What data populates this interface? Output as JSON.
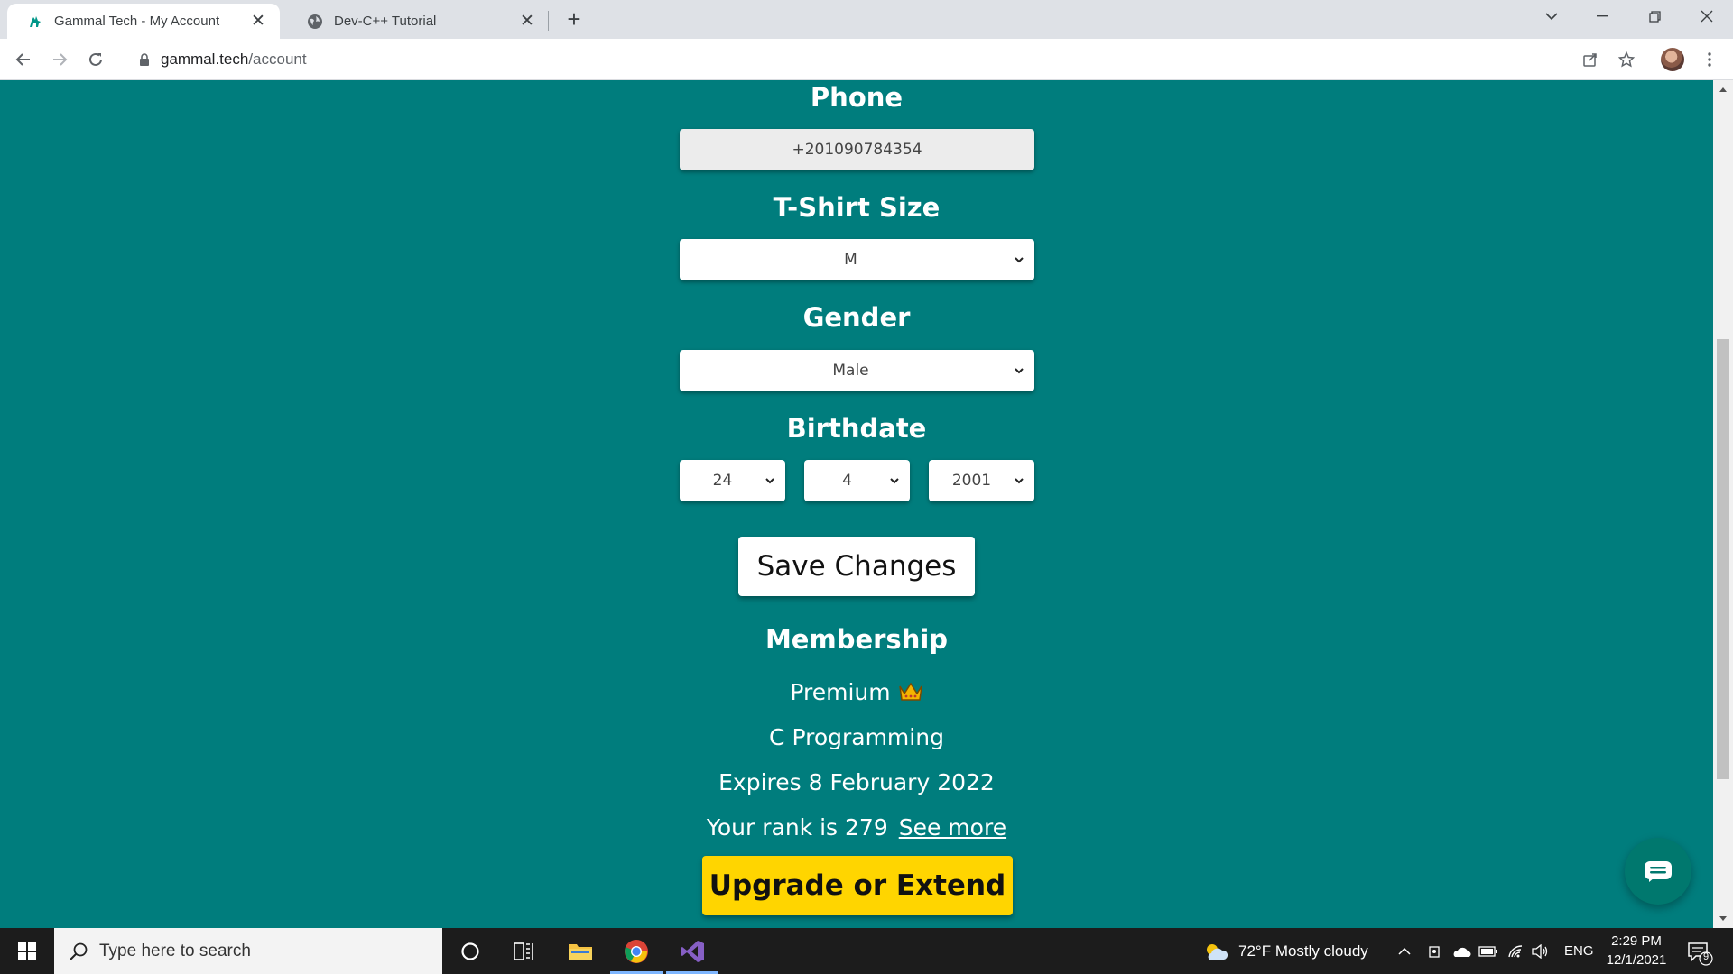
{
  "browser": {
    "tabs": [
      {
        "title": "Gammal Tech - My Account",
        "active": true
      },
      {
        "title": "Dev-C++ Tutorial",
        "active": false
      }
    ],
    "url_host": "gammal.tech",
    "url_path": "/account"
  },
  "form": {
    "phone_label": "Phone",
    "phone_value": "+201090784354",
    "tshirt_label": "T-Shirt Size",
    "tshirt_value": "M",
    "gender_label": "Gender",
    "gender_value": "Male",
    "birthdate_label": "Birthdate",
    "birth_day": "24",
    "birth_month": "4",
    "birth_year": "2001",
    "save_label": "Save Changes"
  },
  "membership": {
    "heading": "Membership",
    "plan": "Premium",
    "course": "C Programming",
    "expires": "Expires 8 February 2022",
    "rank_text": "Your rank is 279",
    "see_more": "See more",
    "upgrade_label": "Upgrade or Extend"
  },
  "taskbar": {
    "search_placeholder": "Type here to search",
    "weather": "72°F  Mostly cloudy",
    "language": "ENG",
    "time": "2:29 PM",
    "date": "12/1/2021",
    "notification_count": "9"
  },
  "colors": {
    "page_bg": "#007d7d",
    "upgrade_bg": "#ffd500",
    "chat_bg": "#00786e"
  },
  "icons": [
    "camel-favicon-icon",
    "globe-icon",
    "close-icon",
    "plus-icon",
    "chevron-down-icon",
    "minimize-icon",
    "restore-icon",
    "back-icon",
    "forward-icon",
    "reload-icon",
    "lock-icon",
    "share-icon",
    "star-icon",
    "menu-icon",
    "crown-icon",
    "chat-icon",
    "windows-icon",
    "search-icon",
    "cortana-icon",
    "task-view-icon",
    "file-explorer-icon",
    "chrome-icon",
    "visual-studio-icon",
    "weather-icon",
    "notification-icon"
  ]
}
